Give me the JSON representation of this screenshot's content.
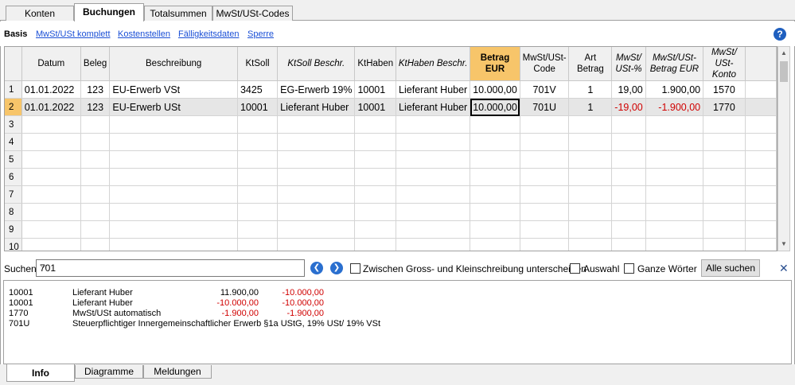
{
  "tabs": [
    "Konten",
    "Buchungen",
    "Totalsummen",
    "MwSt/USt-Codes"
  ],
  "active_tab": "Buchungen",
  "views": [
    "Basis",
    "MwSt/USt komplett",
    "Kostenstellen",
    "Fälligkeitsdaten",
    "Sperre"
  ],
  "help_symbol": "?",
  "columns": [
    {
      "label": "",
      "italic": false
    },
    {
      "label": "Datum",
      "italic": false
    },
    {
      "label": "Beleg",
      "italic": false
    },
    {
      "label": "Beschreibung",
      "italic": false
    },
    {
      "label": "KtSoll",
      "italic": false
    },
    {
      "label": "KtSoll Beschr.",
      "italic": true
    },
    {
      "label": "KtHaben",
      "italic": false
    },
    {
      "label": "KtHaben Beschr.",
      "italic": true
    },
    {
      "label": "Betrag EUR",
      "italic": false
    },
    {
      "label": "MwSt/USt-Code",
      "italic": false
    },
    {
      "label": "Art Betrag",
      "italic": false
    },
    {
      "label": "MwSt/ USt-%",
      "italic": true
    },
    {
      "label": "MwSt/USt-Betrag EUR",
      "italic": true
    },
    {
      "label": "MwSt/ USt-Konto",
      "italic": true
    }
  ],
  "rows": [
    {
      "n": "1",
      "datum": "01.01.2022",
      "beleg": "123",
      "beschreibung": "EU-Erwerb VSt",
      "ktsoll": "3425",
      "ktsoll_beschr": "EG-Erwerb 19%",
      "kthaben": "10001",
      "kthaben_beschr": "Lieferant Huber",
      "betrag": "10.000,00",
      "code": "701V",
      "art": "1",
      "pct": "19,00",
      "mwst": "1.900,00",
      "konto": "1570",
      "red": false
    },
    {
      "n": "2",
      "datum": "01.01.2022",
      "beleg": "123",
      "beschreibung": "EU-Erwerb USt",
      "ktsoll": "10001",
      "ktsoll_beschr": "Lieferant Huber",
      "kthaben": "10001",
      "kthaben_beschr": "Lieferant Huber",
      "betrag": "10.000,00",
      "code": "701U",
      "art": "1",
      "pct": "-19,00",
      "mwst": "-1.900,00",
      "konto": "1770",
      "red": true
    },
    {
      "n": "3"
    },
    {
      "n": "4"
    },
    {
      "n": "5"
    },
    {
      "n": "6"
    },
    {
      "n": "7"
    },
    {
      "n": "8"
    },
    {
      "n": "9"
    },
    {
      "n": "10"
    }
  ],
  "current_row": 2,
  "search": {
    "label": "Suchen",
    "value": "701",
    "case_label": "Zwischen Gross- und Kleinschreibung unterscheiden",
    "selection_label": "Auswahl",
    "whole_words_label": "Ganze Wörter",
    "button": "Alle suchen",
    "close": "✕"
  },
  "info_lines": [
    {
      "a": "10001",
      "b": "Lieferant Huber",
      "c": "11.900,00",
      "d": "-10.000,00",
      "c_red": false,
      "d_red": true
    },
    {
      "a": "10001",
      "b": "Lieferant Huber",
      "c": "-10.000,00",
      "d": "-10.000,00",
      "c_red": true,
      "d_red": true
    },
    {
      "a": "1770",
      "b": "MwSt/USt automatisch",
      "c": "-1.900,00",
      "d": "-1.900,00",
      "c_red": true,
      "d_red": true
    },
    {
      "a": "701U",
      "b": "Steuerpflichtiger Innergemeinschaftlicher Erwerb §1a UStG, 19% USt/ 19% VSt",
      "c": "",
      "d": "",
      "c_red": false,
      "d_red": false
    }
  ],
  "bottom_tabs": [
    "Info",
    "Diagramme",
    "Meldungen"
  ],
  "colors": {
    "selected": "#f7c56a",
    "negative": "#d00000",
    "link": "#1a4fd6"
  }
}
